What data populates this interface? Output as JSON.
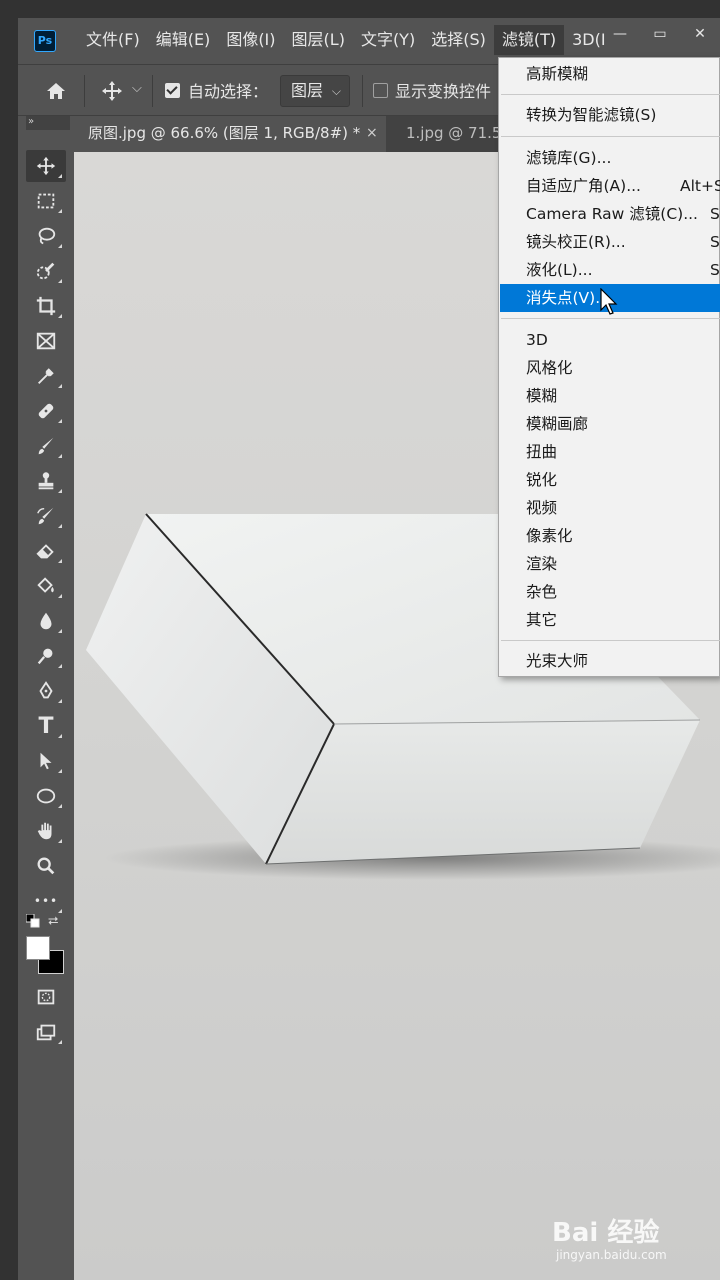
{
  "app": {
    "logo_text": "Ps"
  },
  "menubar": {
    "items": [
      "文件(F)",
      "编辑(E)",
      "图像(I)",
      "图层(L)",
      "文字(Y)",
      "选择(S)",
      "滤镜(T)",
      "3D(I"
    ],
    "active_index": 6
  },
  "window_controls": {
    "minimize": "—",
    "restore": "▭",
    "close": "✕"
  },
  "options": {
    "auto_select_label": "自动选择：",
    "auto_select_checked": true,
    "layer_select_value": "图层",
    "show_transform_label": "显示变换控件",
    "show_transform_checked": false
  },
  "tabs": [
    {
      "label": "原图.jpg @ 66.6% (图层 1, RGB/8#) *",
      "active": true,
      "close": "×"
    },
    {
      "label": "1.jpg @ 71.5",
      "active": false
    }
  ],
  "toolbar": {
    "collapse_glyph": "»",
    "tools": [
      "move-tool",
      "marquee-tool",
      "lasso-tool",
      "quick-select-tool",
      "crop-tool",
      "frame-tool",
      "eyedropper-tool",
      "healing-brush-tool",
      "brush-tool",
      "stamp-tool",
      "history-brush-tool",
      "eraser-tool",
      "paint-bucket-tool",
      "blur-tool",
      "dodge-tool",
      "pen-tool",
      "type-tool",
      "path-select-tool",
      "ellipse-tool",
      "hand-tool",
      "zoom-tool",
      "more-tools",
      "quick-mask-tool",
      "screen-mode-tool"
    ],
    "type_tool_glyph": "T",
    "more_glyph": "•••",
    "foreground_color": "#ffffff",
    "background_color": "#000000"
  },
  "filter_menu": {
    "items": [
      {
        "label": "高斯模糊",
        "shortcut": ""
      },
      {
        "label": "转换为智能滤镜(S)",
        "shortcut": ""
      },
      {
        "label": "滤镜库(G)...",
        "shortcut": ""
      },
      {
        "label": "自适应广角(A)...",
        "shortcut": "Alt+S"
      },
      {
        "label": "Camera Raw 滤镜(C)...",
        "shortcut": "S"
      },
      {
        "label": "镜头校正(R)...",
        "shortcut": "S"
      },
      {
        "label": "液化(L)...",
        "shortcut": "S"
      },
      {
        "label": "消失点(V)...",
        "shortcut": ""
      },
      {
        "label": "3D",
        "shortcut": ""
      },
      {
        "label": "风格化",
        "shortcut": ""
      },
      {
        "label": "模糊",
        "shortcut": ""
      },
      {
        "label": "模糊画廊",
        "shortcut": ""
      },
      {
        "label": "扭曲",
        "shortcut": ""
      },
      {
        "label": "锐化",
        "shortcut": ""
      },
      {
        "label": "视频",
        "shortcut": ""
      },
      {
        "label": "像素化",
        "shortcut": ""
      },
      {
        "label": "渲染",
        "shortcut": ""
      },
      {
        "label": "杂色",
        "shortcut": ""
      },
      {
        "label": "其它",
        "shortcut": ""
      },
      {
        "label": "光束大师",
        "shortcut": ""
      }
    ],
    "highlighted_index": 7,
    "highlight_color": "#0078d7"
  },
  "watermark": {
    "brand": "Bai 经验",
    "url": "jingyan.baidu.com"
  }
}
